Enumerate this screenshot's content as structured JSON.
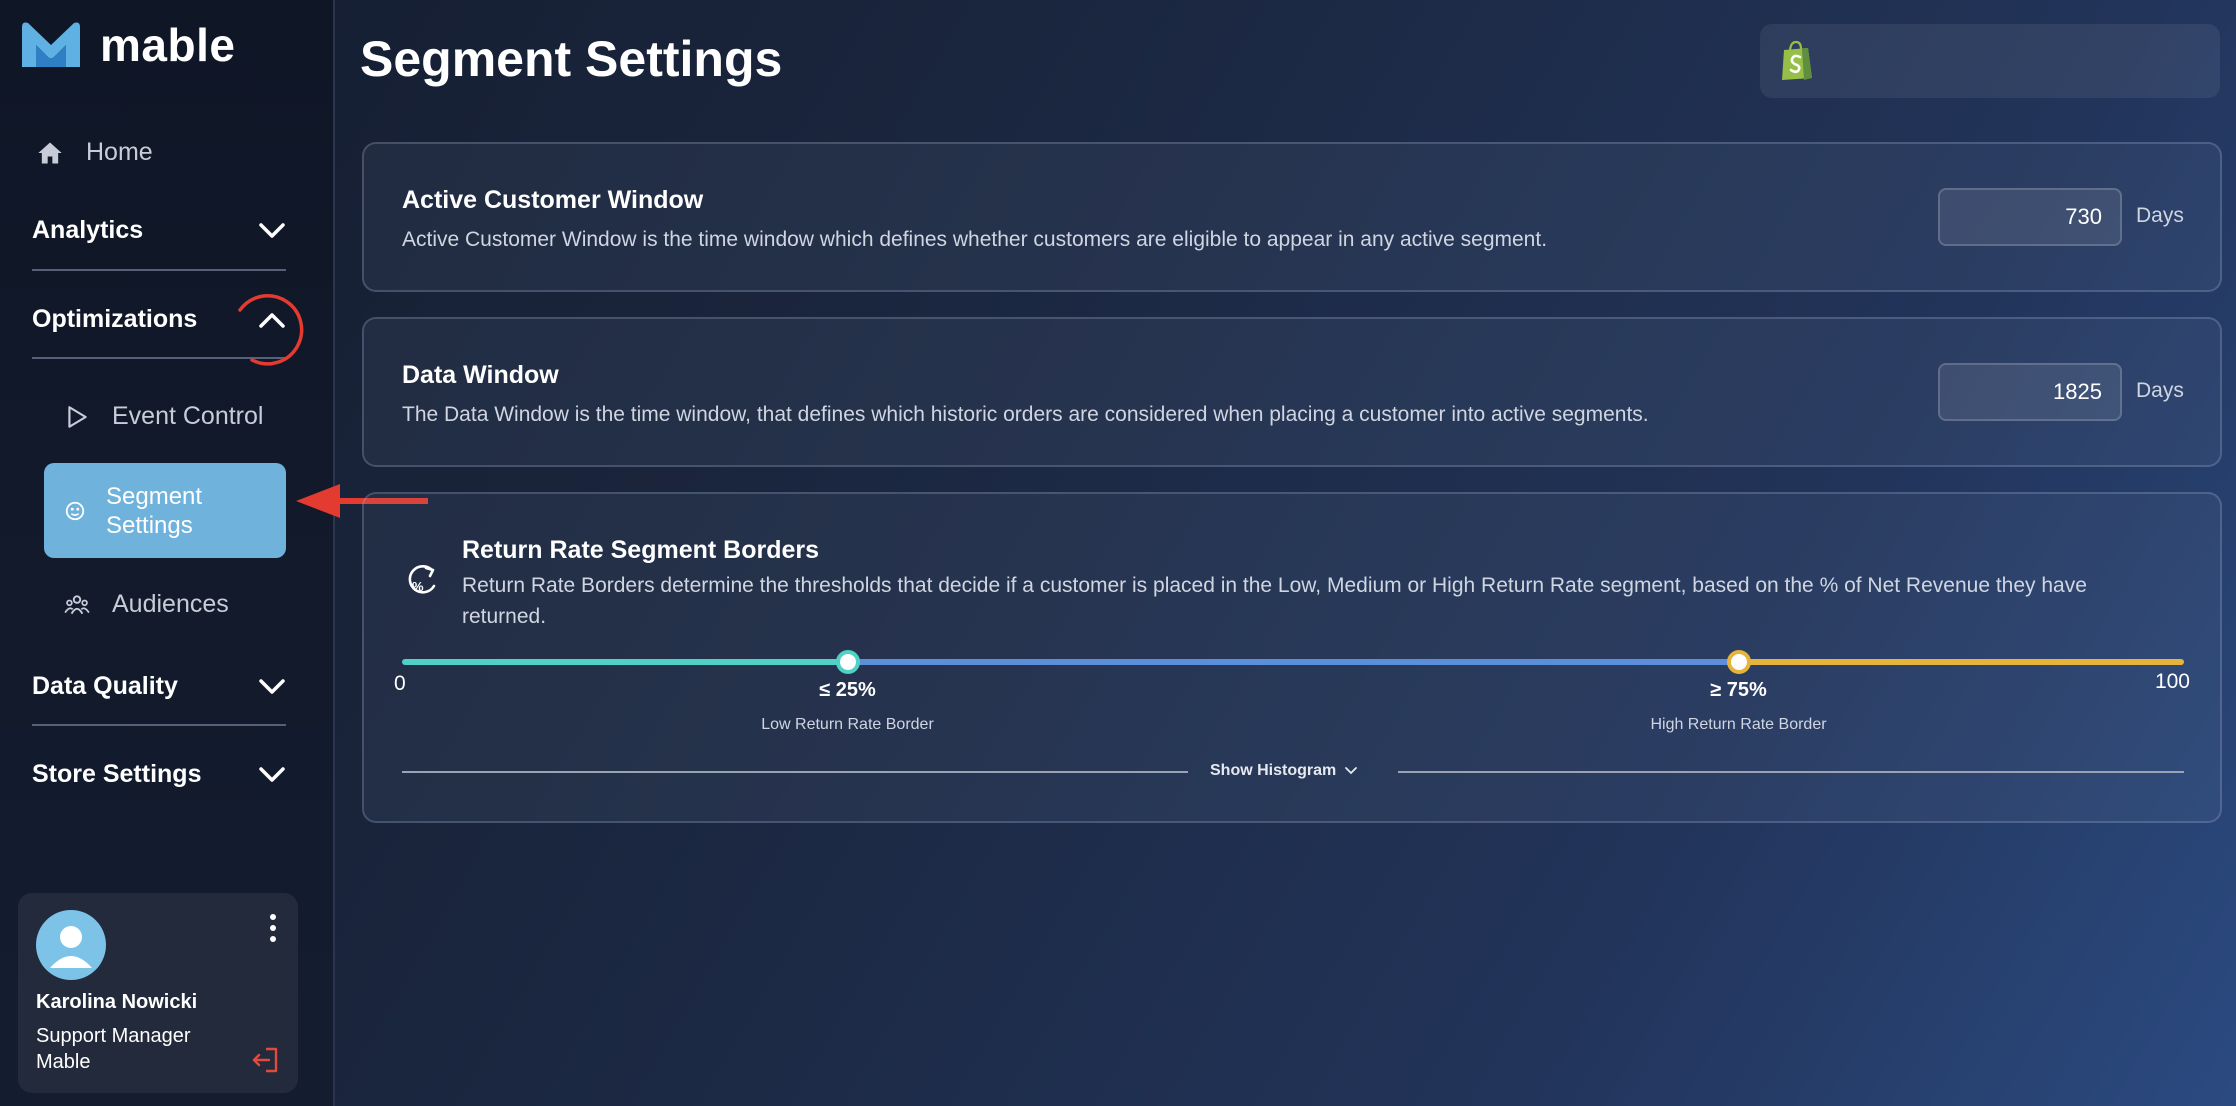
{
  "brand": {
    "name": "mable"
  },
  "nav": {
    "home": "Home",
    "analytics": "Analytics",
    "optimizations": "Optimizations",
    "event_control": "Event Control",
    "segment_settings": "Segment\nSettings",
    "audiences": "Audiences",
    "data_quality": "Data Quality",
    "store_settings": "Store Settings"
  },
  "user": {
    "name": "Karolina Nowicki",
    "role": "Support Manager",
    "company": "Mable"
  },
  "page": {
    "title": "Segment Settings"
  },
  "active_window": {
    "title": "Active Customer Window",
    "description": "Active Customer Window is the time window which defines whether customers are eligible to appear in any active segment.",
    "value": "730",
    "unit": "Days"
  },
  "data_window": {
    "title": "Data Window",
    "description": "The Data Window is the time window, that defines which historic orders are considered when placing a customer into active segments.",
    "value": "1825",
    "unit": "Days"
  },
  "return_rate": {
    "title": "Return Rate Segment Borders",
    "description": "Return Rate Borders determine the thresholds that decide if a customer is placed in the Low, Medium or High Return Rate segment, based on the % of Net Revenue they have returned.",
    "min_label": "0",
    "max_label": "100",
    "low_value": 25,
    "high_value": 75,
    "low_text": "≤ 25%",
    "high_text": "≥ 75%",
    "low_label": "Low Return Rate Border",
    "high_label": "High Return Rate Border",
    "histogram_toggle": "Show Histogram"
  },
  "colors": {
    "low_segment": "#4fd1c5",
    "mid_segment": "#5b8fd9",
    "high_segment": "#e6b43a",
    "active_nav": "#6fb2dc",
    "annotation": "#e33b2f"
  }
}
